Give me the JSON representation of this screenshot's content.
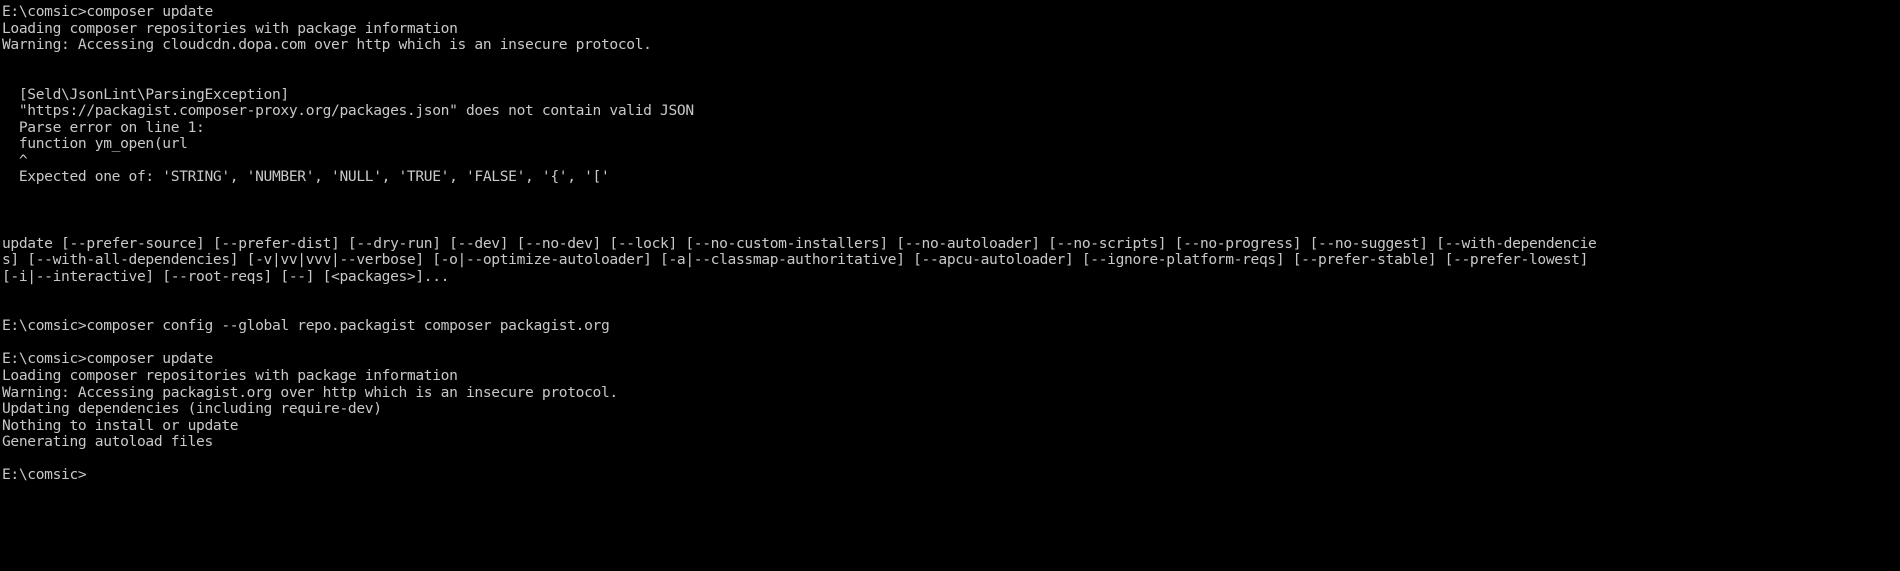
{
  "terminal": {
    "app": "windows-command-prompt",
    "background_color": "#000000",
    "foreground_color": "#c8c8c8",
    "prompt": "E:\\comsic>",
    "lines": [
      "E:\\comsic>composer update",
      "Loading composer repositories with package information",
      "Warning: Accessing cloudcdn.dopa.com over http which is an insecure protocol.",
      "",
      "",
      "  [Seld\\JsonLint\\ParsingException]",
      "  \"https://packagist.composer-proxy.org/packages.json\" does not contain valid JSON",
      "  Parse error on line 1:",
      "  function ym_open(url",
      "  ^",
      "  Expected one of: 'STRING', 'NUMBER', 'NULL', 'TRUE', 'FALSE', '{', '['",
      "",
      "",
      "",
      "update [--prefer-source] [--prefer-dist] [--dry-run] [--dev] [--no-dev] [--lock] [--no-custom-installers] [--no-autoloader] [--no-scripts] [--no-progress] [--no-suggest] [--with-dependencie",
      "s] [--with-all-dependencies] [-v|vv|vvv|--verbose] [-o|--optimize-autoloader] [-a|--classmap-authoritative] [--apcu-autoloader] [--ignore-platform-reqs] [--prefer-stable] [--prefer-lowest]",
      "[-i|--interactive] [--root-reqs] [--] [<packages>]...",
      "",
      "",
      "E:\\comsic>composer config --global repo.packagist composer packagist.org",
      "",
      "E:\\comsic>composer update",
      "Loading composer repositories with package information",
      "Warning: Accessing packagist.org over http which is an insecure protocol.",
      "Updating dependencies (including require-dev)",
      "Nothing to install or update",
      "Generating autoload files",
      "",
      "E:\\comsic>"
    ]
  }
}
